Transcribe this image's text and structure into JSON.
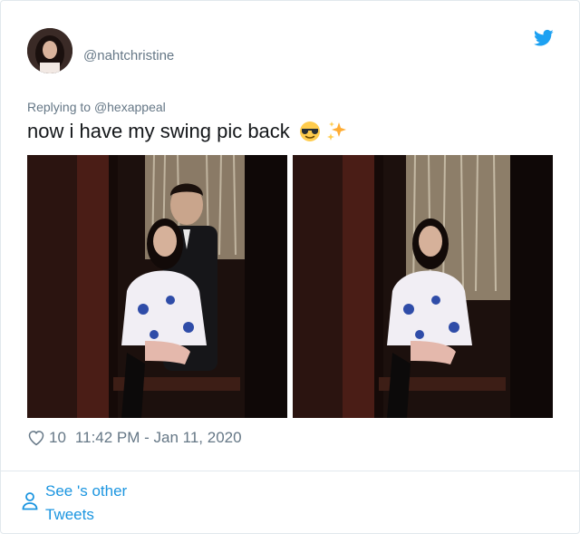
{
  "tweet": {
    "handle": "@nahtchristine",
    "reply_prefix": "Replying to",
    "reply_to": "@hexappeal",
    "text": "now i have my swing pic back",
    "emoji": [
      "sunglasses-emoji",
      "sparkles-emoji"
    ],
    "likes": "10",
    "timestamp": "11:42 PM - Jan 11, 2020"
  },
  "footer": {
    "see_other_tweets": "See 's other Tweets"
  },
  "colors": {
    "twitter_blue": "#1da1f2",
    "link_blue": "#1b95e0",
    "muted_gray": "#657786",
    "border": "#e1e8ed"
  },
  "icons": [
    "twitter-bird-icon",
    "heart-icon",
    "person-icon"
  ]
}
